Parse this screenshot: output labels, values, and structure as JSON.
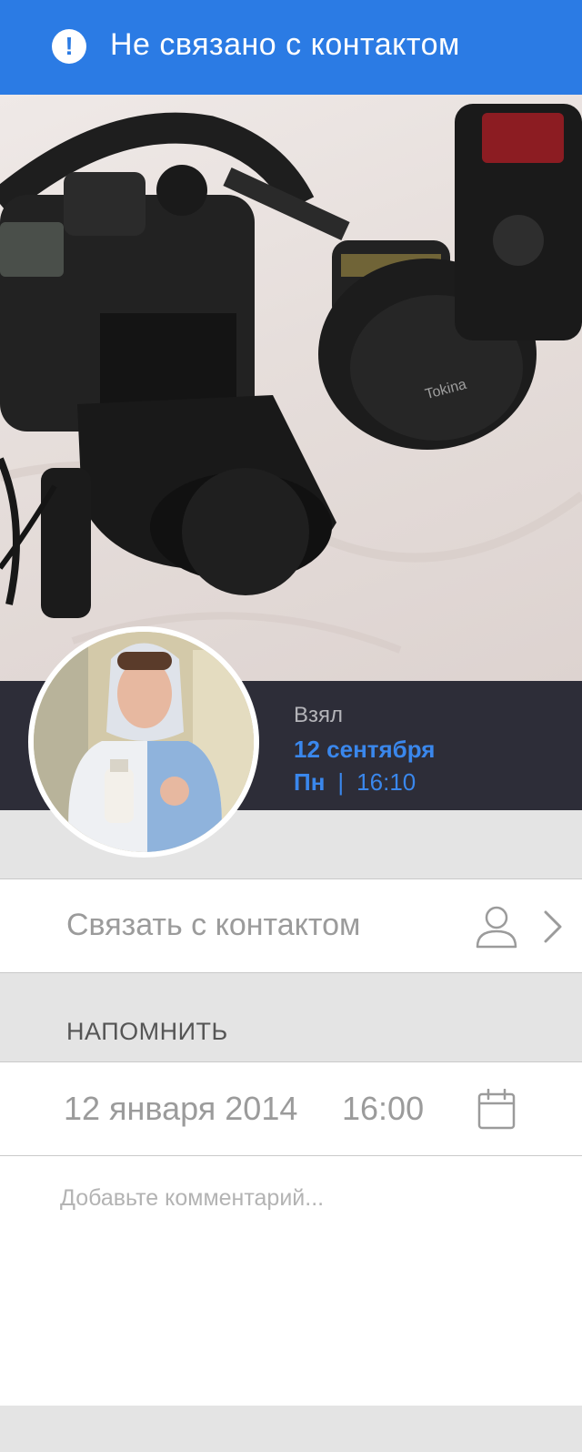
{
  "banner": {
    "icon": "alert-circle-icon",
    "title": "Не связано с контактом",
    "color": "#2b7be4"
  },
  "photo": {
    "subject": "camera-gear-photo"
  },
  "info": {
    "action": "Взял",
    "date": "12 сентября",
    "day": "Пн",
    "separator": "|",
    "time": "16:10",
    "accent_color": "#3a87ec"
  },
  "contact_link": {
    "label": "Связать с контактом",
    "icon": "person-icon",
    "chevron": "chevron-right-icon"
  },
  "reminder": {
    "header": "НАПОМНИТЬ",
    "date": "12 января 2014",
    "time": "16:00",
    "icon": "calendar-icon"
  },
  "comment": {
    "placeholder": "Добавьте комментарий...",
    "value": ""
  }
}
